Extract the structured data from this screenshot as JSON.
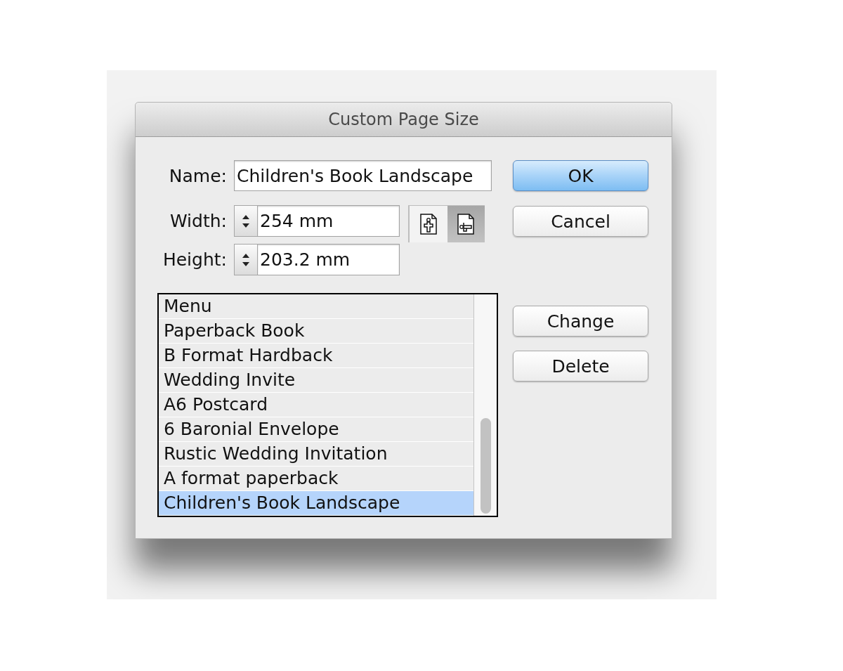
{
  "window": {
    "title": "Custom Page Size"
  },
  "fields": [
    {
      "label": "Name:",
      "value": "Children's Book Landscape",
      "kind": "text"
    },
    {
      "label": "Width:",
      "value": "254 mm",
      "kind": "stepper"
    },
    {
      "label": "Height:",
      "value": "203.2 mm",
      "kind": "stepper"
    }
  ],
  "orientation": [
    {
      "kind": "portrait",
      "selected": false
    },
    {
      "kind": "landscape",
      "selected": true
    }
  ],
  "list": {
    "items": [
      {
        "label": "Menu",
        "selected": false
      },
      {
        "label": "Paperback Book",
        "selected": false
      },
      {
        "label": "B Format Hardback",
        "selected": false
      },
      {
        "label": "Wedding Invite",
        "selected": false
      },
      {
        "label": "A6 Postcard",
        "selected": false
      },
      {
        "label": "6 Baronial Envelope",
        "selected": false
      },
      {
        "label": "Rustic Wedding Invitation",
        "selected": false
      },
      {
        "label": "A format paperback",
        "selected": false
      },
      {
        "label": "Children's Book Landscape",
        "selected": true
      }
    ]
  },
  "buttons": [
    {
      "label": "OK",
      "default": true
    },
    {
      "label": "Cancel",
      "default": false
    }
  ],
  "list_buttons": [
    {
      "label": "Change",
      "default": false
    },
    {
      "label": "Delete",
      "default": false
    }
  ]
}
